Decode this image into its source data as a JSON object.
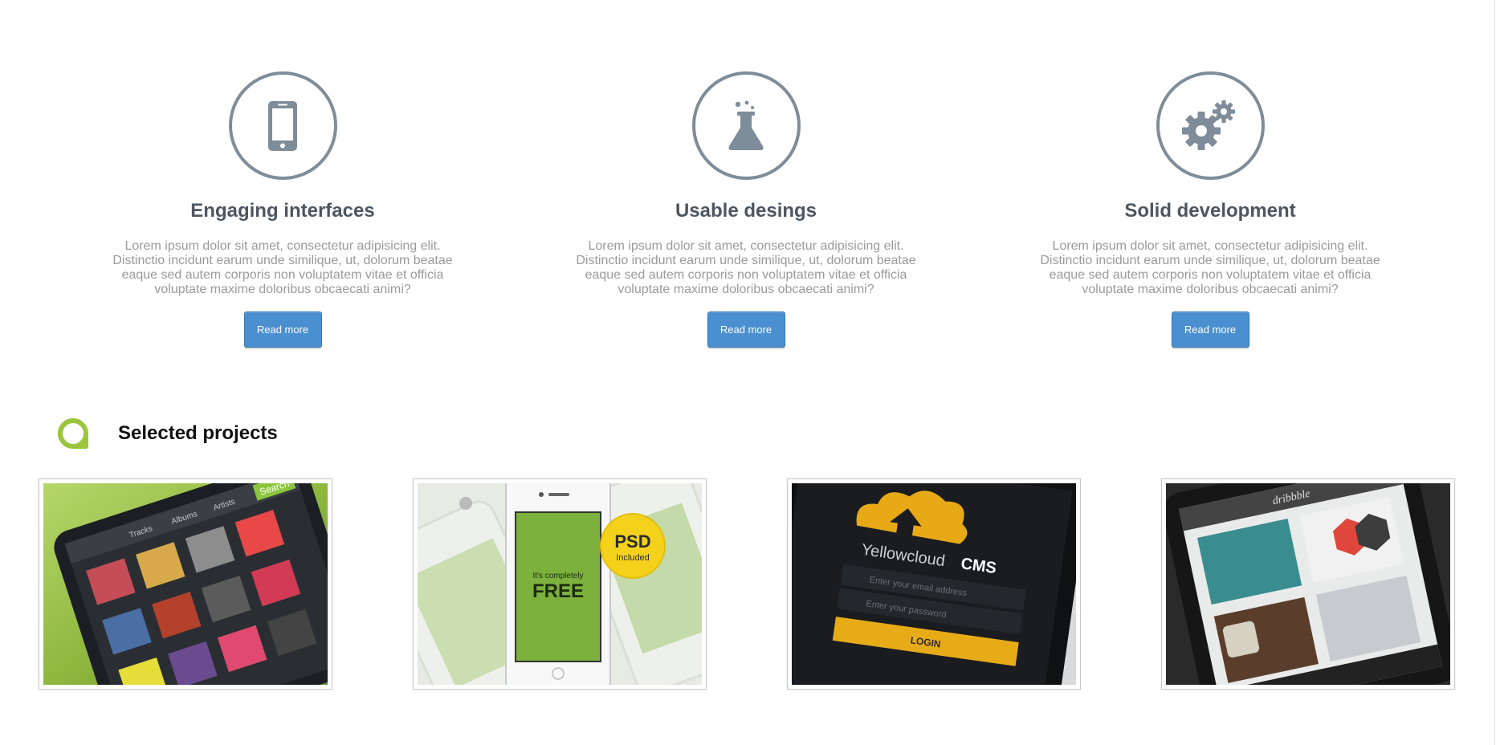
{
  "features": [
    {
      "icon": "smartphone-icon",
      "title": "Engaging interfaces",
      "text": "Lorem ipsum dolor sit amet, consectetur adipisicing elit. Distinctio incidunt earum unde similique, ut, dolorum beatae eaque sed autem corporis non voluptatem vitae et officia voluptate maxime doloribus obcaecati animi?",
      "button": "Read more"
    },
    {
      "icon": "flask-icon",
      "title": "Usable desings",
      "text": "Lorem ipsum dolor sit amet, consectetur adipisicing elit. Distinctio incidunt earum unde similique, ut, dolorum beatae eaque sed autem corporis non voluptatem vitae et officia voluptate maxime doloribus obcaecati animi?",
      "button": "Read more"
    },
    {
      "icon": "gears-icon",
      "title": "Solid development",
      "text": "Lorem ipsum dolor sit amet, consectetur adipisicing elit. Distinctio incidunt earum unde similique, ut, dolorum beatae eaque sed autem corporis non voluptatem vitae et officia voluptate maxime doloribus obcaecati animi?",
      "button": "Read more"
    }
  ],
  "section": {
    "title": "Selected projects",
    "icon": "speech-bubble-icon"
  },
  "projects": [
    {
      "name": "music-app-thumbnail",
      "labels": [
        "Search",
        "Tracks",
        "Albums",
        "Artists"
      ]
    },
    {
      "name": "free-iphone-mockup-thumbnail",
      "labels": [
        "PSD",
        "Included",
        "It's completely",
        "FREE"
      ]
    },
    {
      "name": "yellowcloud-cms-thumbnail",
      "labels": [
        "Yellowcloud",
        "CMS",
        "Enter your email address",
        "Enter your password",
        "LOGIN"
      ]
    },
    {
      "name": "dribbble-app-thumbnail",
      "labels": [
        "dribbble"
      ]
    }
  ],
  "colors": {
    "icon_gray": "#7f8c99",
    "heading": "#4d5660",
    "body_text": "#9a9a9a",
    "button_blue": "#4a8fcf",
    "accent_green": "#9bc53d"
  }
}
